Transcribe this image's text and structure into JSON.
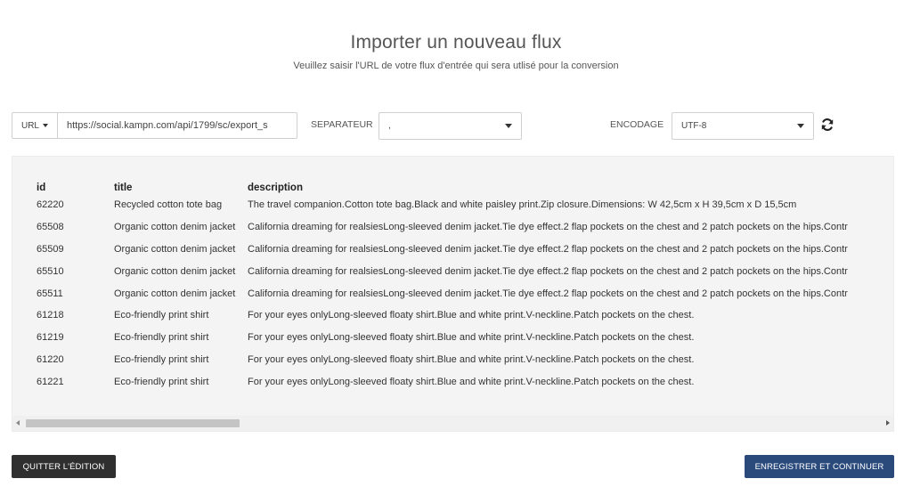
{
  "header": {
    "title": "Importer un nouveau flux",
    "subtitle": "Veuillez saisir l'URL de votre flux d'entrée qui sera utlisé pour la conversion"
  },
  "source": {
    "type_label": "URL",
    "url_value": "https://social.kampn.com/api/1799/sc/export_s"
  },
  "separator": {
    "label": "SEPARATEUR",
    "value": ","
  },
  "encoding": {
    "label": "ENCODAGE",
    "value": "UTF-8"
  },
  "preview": {
    "columns": [
      "id",
      "title",
      "description"
    ],
    "rows": [
      [
        "62220",
        "Recycled cotton tote bag",
        "The travel companion.Cotton tote bag.Black and white paisley print.Zip closure.Dimensions: W 42,5cm x H 39,5cm x D 15,5cm"
      ],
      [
        "65508",
        "Organic cotton denim jacket",
        "California dreaming for realsiesLong-sleeved denim jacket.Tie dye effect.2 flap pockets on the chest and 2 patch pockets on the hips.Contr"
      ],
      [
        "65509",
        "Organic cotton denim jacket",
        "California dreaming for realsiesLong-sleeved denim jacket.Tie dye effect.2 flap pockets on the chest and 2 patch pockets on the hips.Contr"
      ],
      [
        "65510",
        "Organic cotton denim jacket",
        "California dreaming for realsiesLong-sleeved denim jacket.Tie dye effect.2 flap pockets on the chest and 2 patch pockets on the hips.Contr"
      ],
      [
        "65511",
        "Organic cotton denim jacket",
        "California dreaming for realsiesLong-sleeved denim jacket.Tie dye effect.2 flap pockets on the chest and 2 patch pockets on the hips.Contr"
      ],
      [
        "61218",
        "Eco-friendly print shirt",
        "For your eyes onlyLong-sleeved floaty shirt.Blue and white print.V-neckline.Patch pockets on the chest."
      ],
      [
        "61219",
        "Eco-friendly print shirt",
        "For your eyes onlyLong-sleeved floaty shirt.Blue and white print.V-neckline.Patch pockets on the chest."
      ],
      [
        "61220",
        "Eco-friendly print shirt",
        "For your eyes onlyLong-sleeved floaty shirt.Blue and white print.V-neckline.Patch pockets on the chest."
      ],
      [
        "61221",
        "Eco-friendly print shirt",
        "For your eyes onlyLong-sleeved floaty shirt.Blue and white print.V-neckline.Patch pockets on the chest."
      ]
    ]
  },
  "actions": {
    "quit_label": "QUITTER L'ÉDITION",
    "save_label": "ENREGISTRER ET CONTINUER"
  },
  "icons": {
    "refresh": "refresh-icon",
    "dropdown": "chevron-down-icon"
  },
  "colors": {
    "primary": "#2b4a7c",
    "dark": "#2f2f2f",
    "panel": "#f4f4f4"
  }
}
